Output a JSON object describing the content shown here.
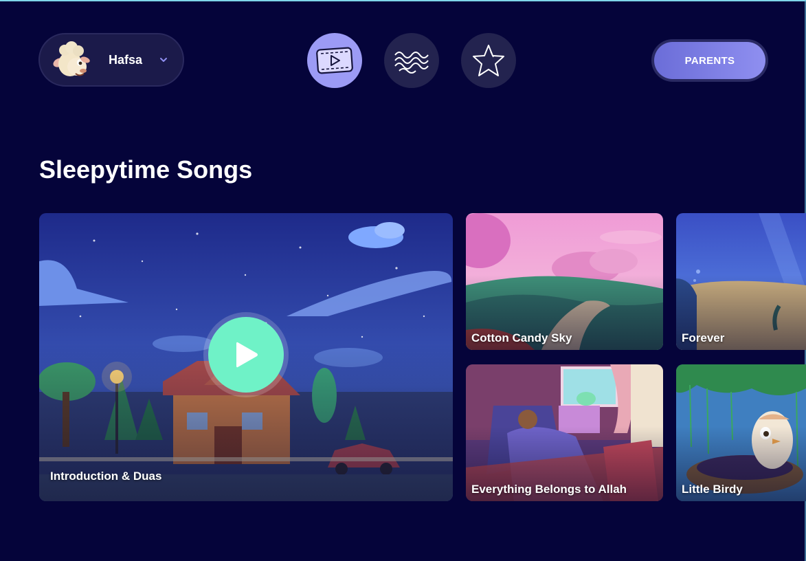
{
  "profile": {
    "name": "Hafsa",
    "avatar_icon": "lamb-avatar",
    "dropdown_icon": "chevron-down-icon"
  },
  "nav": [
    {
      "icon": "video-icon",
      "active": true
    },
    {
      "icon": "waves-icon",
      "active": false
    },
    {
      "icon": "star-icon",
      "active": false
    }
  ],
  "header": {
    "parents_label": "PARENTS"
  },
  "section": {
    "title": "Sleepytime Songs"
  },
  "cards": {
    "featured": {
      "title": "Introduction & Duas",
      "play_icon": "play-icon"
    },
    "items": [
      {
        "title": "Cotton Candy Sky"
      },
      {
        "title": "Forever"
      },
      {
        "title": "Everything Belongs to Allah"
      },
      {
        "title": "Little Birdy"
      }
    ]
  },
  "colors": {
    "background": "#05043a",
    "nav_active": "#9c9bf5",
    "nav_inactive": "#23234f",
    "play_button": "#6ff2c7",
    "parents_button": "#7b7de4"
  }
}
